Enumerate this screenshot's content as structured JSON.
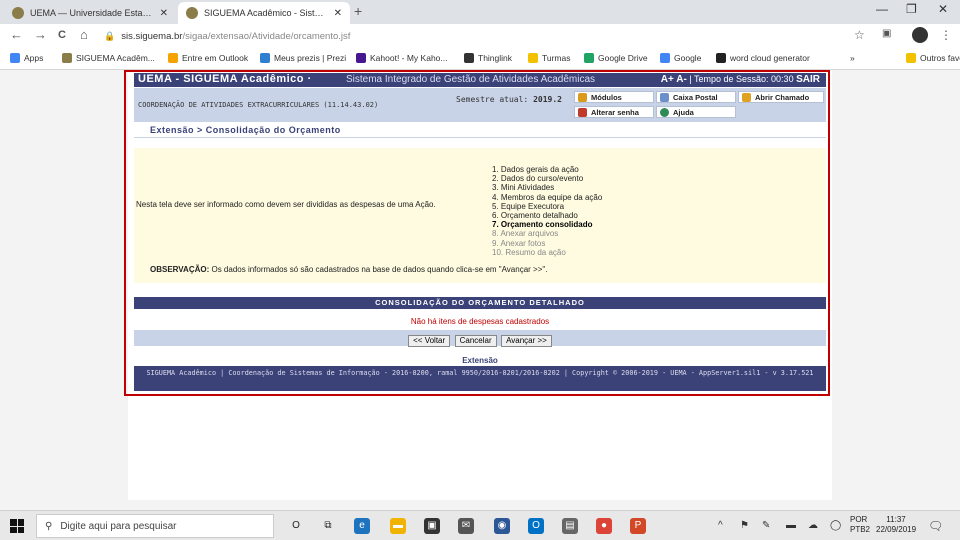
{
  "browser": {
    "tabs": [
      {
        "title": "UEMA — Universidade Estadual d",
        "close": "✕"
      },
      {
        "title": "SIGUEMA Acadêmico - Sistema I",
        "close": "✕"
      }
    ],
    "new_tab": "+",
    "window_controls": {
      "minimize": "—",
      "restore": "❐",
      "close": "✕"
    },
    "nav": {
      "back": "←",
      "forward": "→",
      "reload": "C",
      "home": "⌂"
    },
    "url_host": "sis.siguema.br",
    "url_path": "/sigaa/extensao/Atividade/orcamento.jsf",
    "star": "☆",
    "menu": "⋮"
  },
  "bookmarks": [
    {
      "label": "Apps",
      "color": "#4285f4"
    },
    {
      "label": "SIGUEMA Acadêm...",
      "color": "#8a7d4a"
    },
    {
      "label": "Entre em Outlook",
      "color": "#f4a300"
    },
    {
      "label": "Meus prezis | Prezi",
      "color": "#2c7fd1"
    },
    {
      "label": "Kahoot! - My Kaho...",
      "color": "#46178f"
    },
    {
      "label": "Thinglink",
      "color": "#333333"
    },
    {
      "label": "Turmas",
      "color": "#f2c200"
    },
    {
      "label": "Google Drive",
      "color": "#1fa463"
    },
    {
      "label": "Google",
      "color": "#4285f4"
    },
    {
      "label": "word cloud generator",
      "color": "#222222"
    }
  ],
  "bookmarks_more": "»",
  "bookmarks_other": "Outros favoritos",
  "sig": {
    "brand": "UEMA - SIGUEMA Acadêmico ·",
    "subtitle": "Sistema Integrado de Gestão de Atividades Acadêmicas",
    "font_controls": "A+  A-",
    "session_label": "| Tempo de Sessão: 00:30",
    "logout": "SAIR",
    "unit": "COORDENAÇÃO DE ATIVIDADES EXTRACURRICULARES (11.14.43.02)",
    "semester_label": "Semestre atual:",
    "semester_value": "2019.2",
    "modules": [
      {
        "label": "Módulos",
        "color": "#d99a1e"
      },
      {
        "label": "Caixa Postal",
        "color": "#6a8fc9"
      },
      {
        "label": "Abrir Chamado",
        "color": "#e0a020"
      },
      {
        "label": "Alterar senha",
        "color": "#c0392b"
      },
      {
        "label": "Ajuda",
        "color": "#2e8b57"
      }
    ],
    "breadcrumb": "Extensão > Consolidação do Orçamento",
    "description": "Nesta tela deve ser informado como devem ser divididas as despesas de uma Ação.",
    "steps": [
      {
        "label": "1. Dados gerais da ação",
        "state": "done"
      },
      {
        "label": "2. Dados do curso/evento",
        "state": "done"
      },
      {
        "label": "3. Mini Atividades",
        "state": "done"
      },
      {
        "label": "4. Membros da equipe da ação",
        "state": "done"
      },
      {
        "label": "5. Equipe Executora",
        "state": "done"
      },
      {
        "label": "6. Orçamento detalhado",
        "state": "done"
      },
      {
        "label": "7. Orçamento consolidado",
        "state": "current"
      },
      {
        "label": "8. Anexar arquivos",
        "state": "future"
      },
      {
        "label": "9. Anexar fotos",
        "state": "future"
      },
      {
        "label": "10. Resumo da ação",
        "state": "future"
      }
    ],
    "obs_label": "OBSERVAÇÃO:",
    "obs_text": " Os dados informados só são cadastrados na base de dados quando clica-se em \"Avançar >>\".",
    "section_title": "CONSOLIDAÇÃO DO ORÇAMENTO DETALHADO",
    "empty_message": "Não há itens de despesas cadastrados",
    "buttons": {
      "back": "<< Voltar",
      "cancel": "Cancelar",
      "next": "Avançar >>"
    },
    "ext_link": "Extensão",
    "footer": "SIGUEMA Acadêmico | Coordenação de Sistemas de Informação - 2016-8200, ramal 9950/2016-8201/2016-8202 | Copyright © 2006-2019 - UEMA - AppServer1.sil1 - v 3.17.521"
  },
  "taskbar": {
    "search_placeholder": "Digite aqui para pesquisar",
    "apps": [
      {
        "glyph": "O",
        "color": "#e8e8e8",
        "fg": "#222222"
      },
      {
        "glyph": "⧉",
        "color": "#e8e8e8",
        "fg": "#222222"
      },
      {
        "glyph": "e",
        "color": "#1e73be",
        "fg": "#ffffff"
      },
      {
        "glyph": "▬",
        "color": "#f0b400",
        "fg": "#ffffff"
      },
      {
        "glyph": "▣",
        "color": "#333333",
        "fg": "#ffffff"
      },
      {
        "glyph": "✉",
        "color": "#555555",
        "fg": "#ffffff"
      },
      {
        "glyph": "◉",
        "color": "#2b5797",
        "fg": "#ffffff"
      },
      {
        "glyph": "O",
        "color": "#0072c6",
        "fg": "#ffffff"
      },
      {
        "glyph": "▤",
        "color": "#666666",
        "fg": "#ffffff"
      },
      {
        "glyph": "●",
        "color": "#db4437",
        "fg": "#ffffff"
      },
      {
        "glyph": "P",
        "color": "#d24726",
        "fg": "#ffffff"
      }
    ],
    "tray": [
      "^",
      "⚑",
      "✎",
      "▬",
      "☁",
      "◯"
    ],
    "lang_1": "POR",
    "lang_2": "PTB2",
    "time": "11:37",
    "date": "22/09/2019",
    "notifications": "🗨"
  }
}
